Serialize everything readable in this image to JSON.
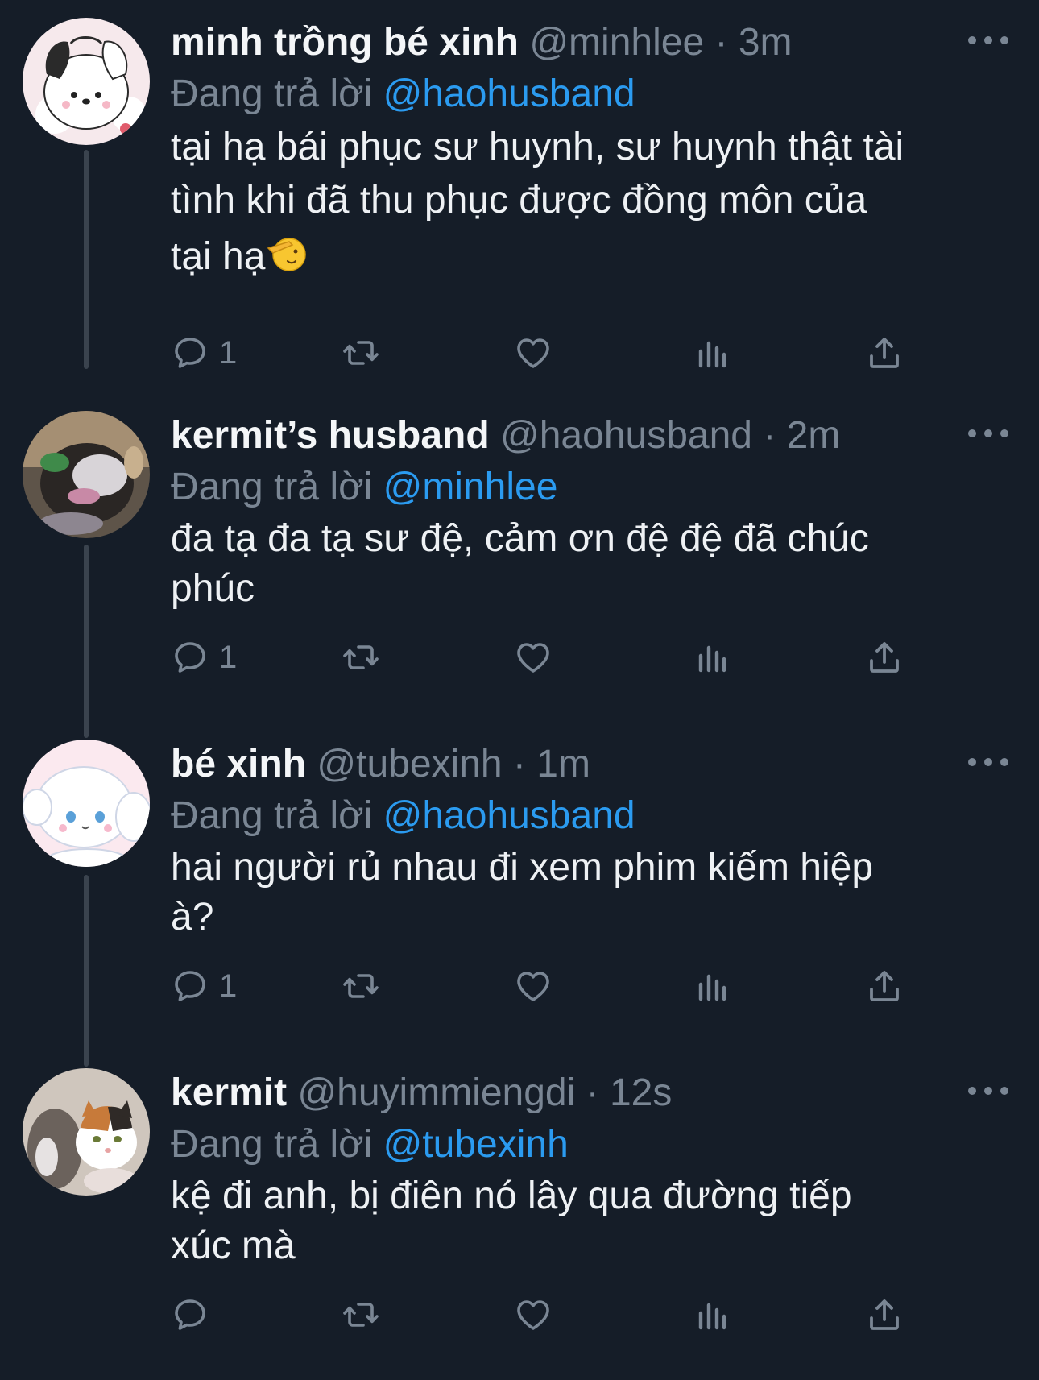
{
  "reply_prefix": "Đang trả lời",
  "tweets": [
    {
      "name": "minh trồng bé xinh",
      "handle": "@minhlee",
      "dot": "·",
      "time": "3m",
      "reply_to": "@haohusband",
      "lines": [
        "tại hạ bái phục sư huynh, sư huynh thật tài",
        "tình khi đã thu phục được đồng môn của",
        "tại hạ"
      ],
      "emoji": "saluting-face",
      "reply_count": "1",
      "avatar": "pochacco-avatar"
    },
    {
      "name": "kermit’s husband",
      "handle": "@haohusband",
      "dot": "·",
      "time": "2m",
      "reply_to": "@minhlee",
      "lines": [
        "đa tạ đa tạ sư đệ, cảm ơn đệ đệ đã chúc",
        "phúc"
      ],
      "reply_count": "1",
      "avatar": "blurry-cat-avatar"
    },
    {
      "name": "bé xinh",
      "handle": "@tubexinh",
      "dot": "·",
      "time": "1m",
      "reply_to": "@haohusband",
      "lines": [
        "hai người rủ nhau đi xem phim kiếm hiệp",
        "à?"
      ],
      "reply_count": "1",
      "avatar": "cinnamoroll-avatar"
    },
    {
      "name": "kermit",
      "handle": "@huyimmiengdi",
      "dot": "·",
      "time": "12s",
      "reply_to": "@tubexinh",
      "lines": [
        "kệ đi anh, bị điên nó lây qua đường tiếp",
        "xúc mà"
      ],
      "reply_count": "",
      "avatar": "calico-cat-avatar"
    }
  ],
  "colors": {
    "background": "#151d28",
    "mention": "#2b9bf0",
    "muted": "#7a8694",
    "thread_line": "#3a434e"
  },
  "icons": [
    "reply-icon",
    "retweet-icon",
    "like-icon",
    "views-icon",
    "share-icon",
    "more-icon"
  ]
}
